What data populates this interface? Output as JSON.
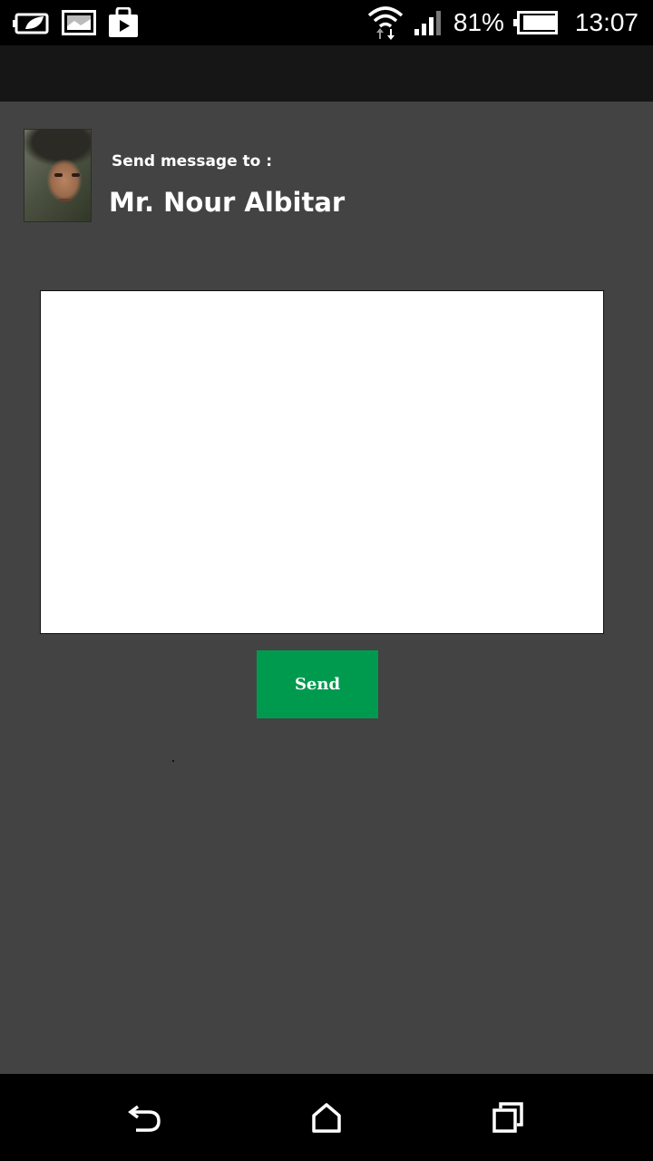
{
  "status_bar": {
    "battery_percent": "81%",
    "time": "13:07",
    "left_icons": [
      "leaf-battery-saver-icon",
      "image-notification-icon",
      "play-store-icon"
    ],
    "right_icons": [
      "wifi-icon",
      "signal-icon",
      "battery-icon"
    ]
  },
  "header": {
    "send_to_label": "Send message to :",
    "recipient_name": "Mr. Nour Albitar",
    "avatar": "recipient-photo"
  },
  "message": {
    "value": "",
    "placeholder": ""
  },
  "actions": {
    "send_label": "Send"
  },
  "nav_bar": {
    "icons": [
      "back-icon",
      "home-icon",
      "recent-apps-icon"
    ]
  },
  "colors": {
    "background": "#434343",
    "status_bar": "#000000",
    "action_bar": "#161616",
    "send_button": "#009A4E",
    "text": "#FFFFFF"
  }
}
